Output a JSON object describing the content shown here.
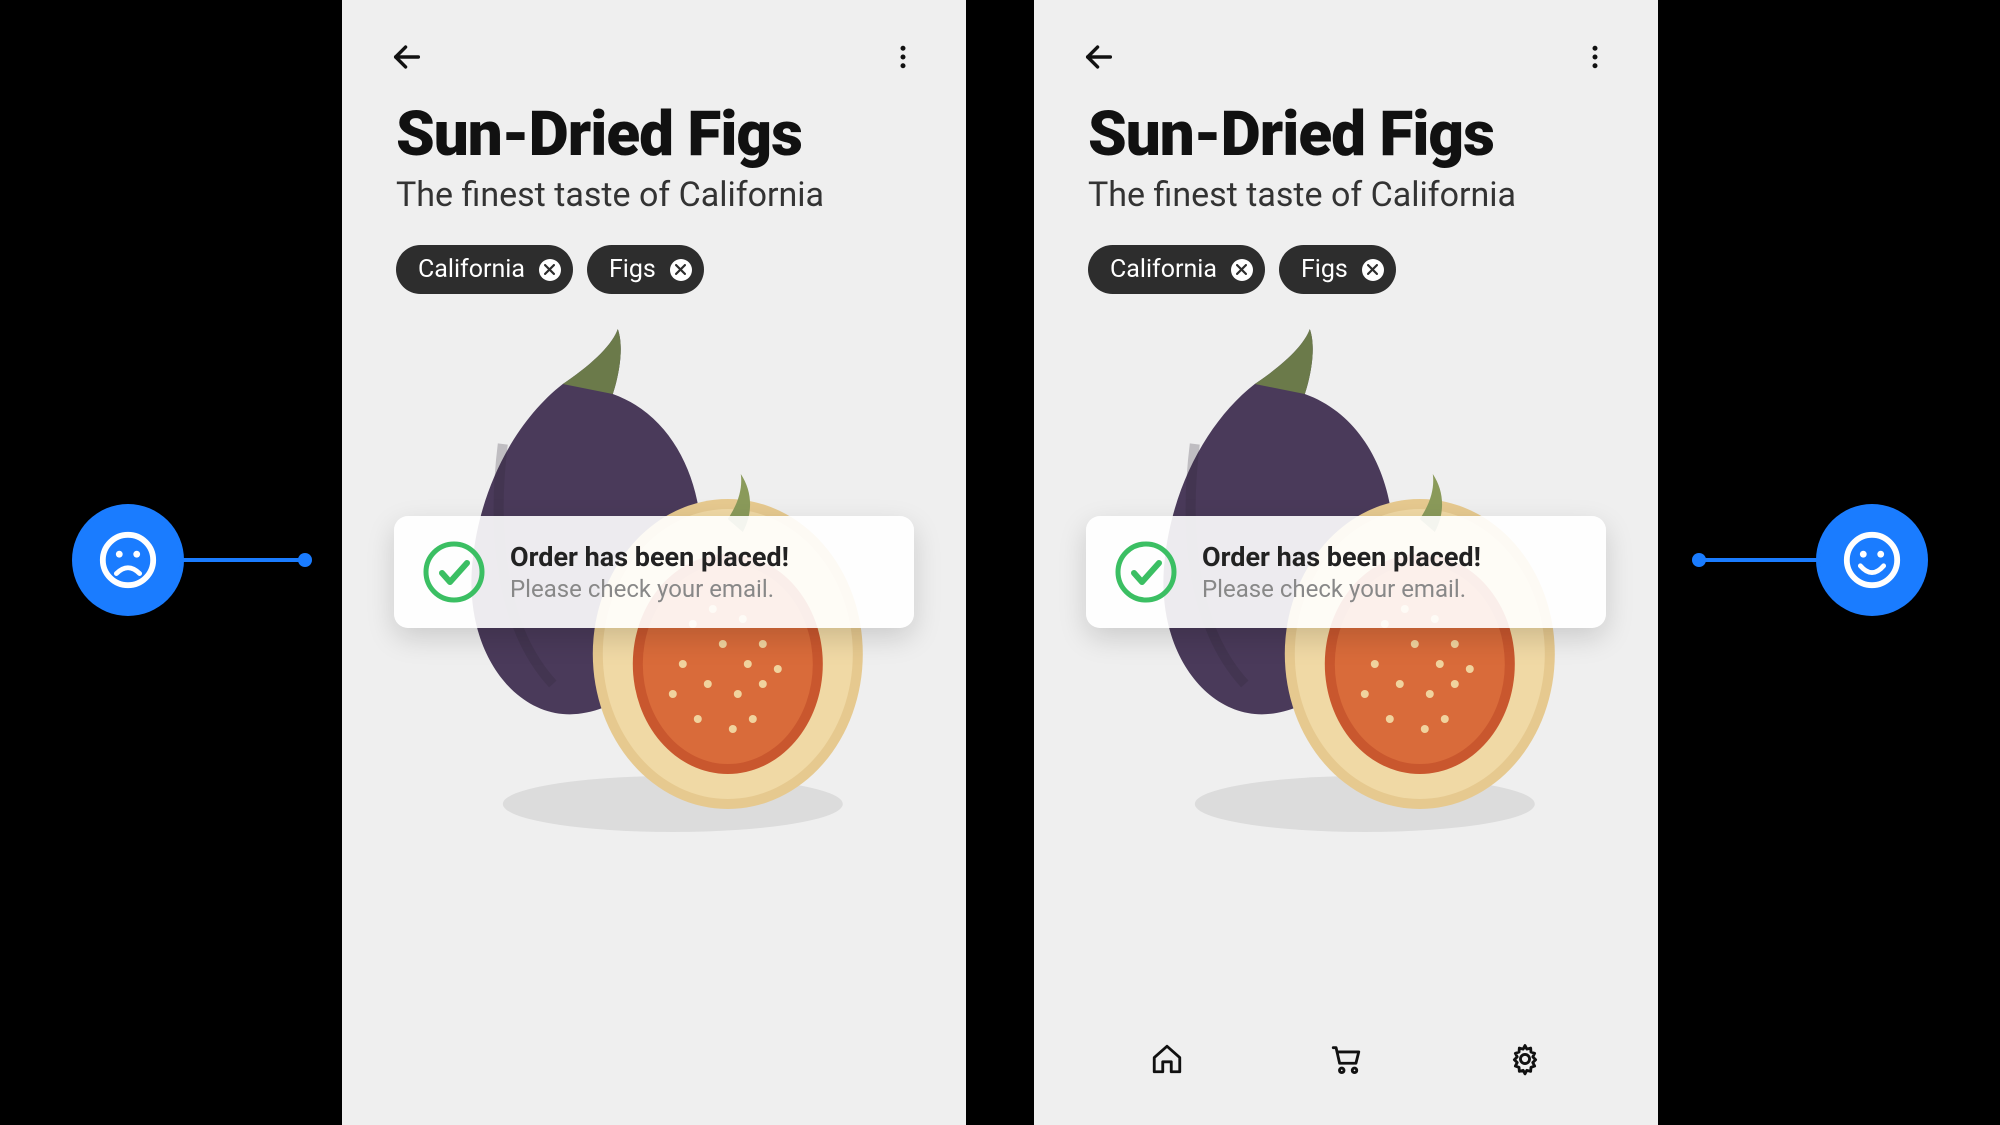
{
  "product": {
    "title": "Sun-Dried Figs",
    "subtitle": "The finest taste of California"
  },
  "chips": [
    {
      "label": "California"
    },
    {
      "label": "Figs"
    }
  ],
  "toast": {
    "title": "Order has been placed!",
    "subtitle": "Please check your email."
  },
  "nav": {
    "home": "Home",
    "cart": "Cart",
    "settings": "Settings"
  },
  "feedback": {
    "left_mood": "sad",
    "right_mood": "happy"
  },
  "colors": {
    "accent_blue": "#1a7cff",
    "success_green": "#3bbf63",
    "chip_bg": "#2d2d2d"
  }
}
